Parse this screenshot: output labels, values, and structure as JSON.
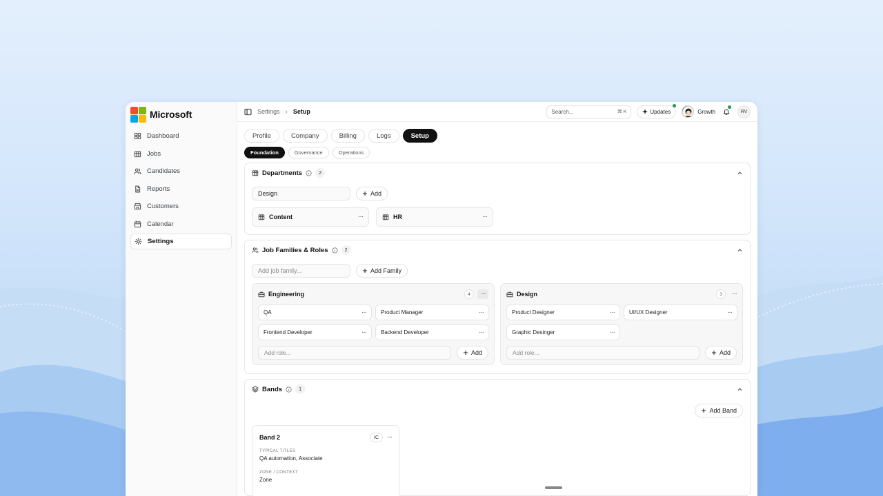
{
  "brand": {
    "name": "Microsoft",
    "logo_colors": [
      "#f25022",
      "#7fba00",
      "#00a4ef",
      "#ffb900"
    ]
  },
  "sidebar": {
    "items": [
      {
        "label": "Dashboard",
        "icon": "dashboard-icon"
      },
      {
        "label": "Jobs",
        "icon": "building-icon"
      },
      {
        "label": "Candidates",
        "icon": "users-icon"
      },
      {
        "label": "Reports",
        "icon": "file-icon"
      },
      {
        "label": "Customers",
        "icon": "store-icon"
      },
      {
        "label": "Calendar",
        "icon": "calendar-icon"
      },
      {
        "label": "Settings",
        "icon": "gear-icon",
        "active": true
      }
    ]
  },
  "topbar": {
    "breadcrumb": [
      "Settings",
      "Setup"
    ],
    "search_placeholder": "Search...",
    "search_shortcut": "⌘ K",
    "updates_label": "Updates",
    "user_label": "Growth",
    "initials": "RV",
    "status_color": "#1e9d52"
  },
  "tabs": [
    "Profile",
    "Company",
    "Billing",
    "Logs",
    "Setup"
  ],
  "active_tab": "Setup",
  "subtabs": [
    "Foundation",
    "Governance",
    "Operations"
  ],
  "active_subtab": "Foundation",
  "departments": {
    "title": "Departments",
    "count": "2",
    "input_value": "Design",
    "add_label": "Add",
    "items": [
      "Content",
      "HR"
    ]
  },
  "job_families": {
    "title": "Job Families & Roles",
    "count": "2",
    "input_placeholder": "Add job family...",
    "add_label": "Add Family",
    "families": [
      {
        "name": "Engineering",
        "count": "4",
        "roles": [
          "QA",
          "Product Manager",
          "Frontend Developer",
          "Backend Developer"
        ],
        "add_placeholder": "Add role...",
        "add_label": "Add"
      },
      {
        "name": "Design",
        "count": "3",
        "roles": [
          "Product Designer",
          "UI/UX Designer",
          "Graphic Desinger"
        ],
        "add_placeholder": "Add role...",
        "add_label": "Add"
      }
    ]
  },
  "bands": {
    "title": "Bands",
    "count": "1",
    "add_label": "Add Band",
    "items": [
      {
        "name": "Band 2",
        "badge": "IC",
        "typical_titles_label": "TYPICAL TITLES",
        "typical_titles": "QA automation, Associate",
        "zone_label": "ZONE / CONTEXT",
        "zone": "Zone"
      }
    ]
  }
}
